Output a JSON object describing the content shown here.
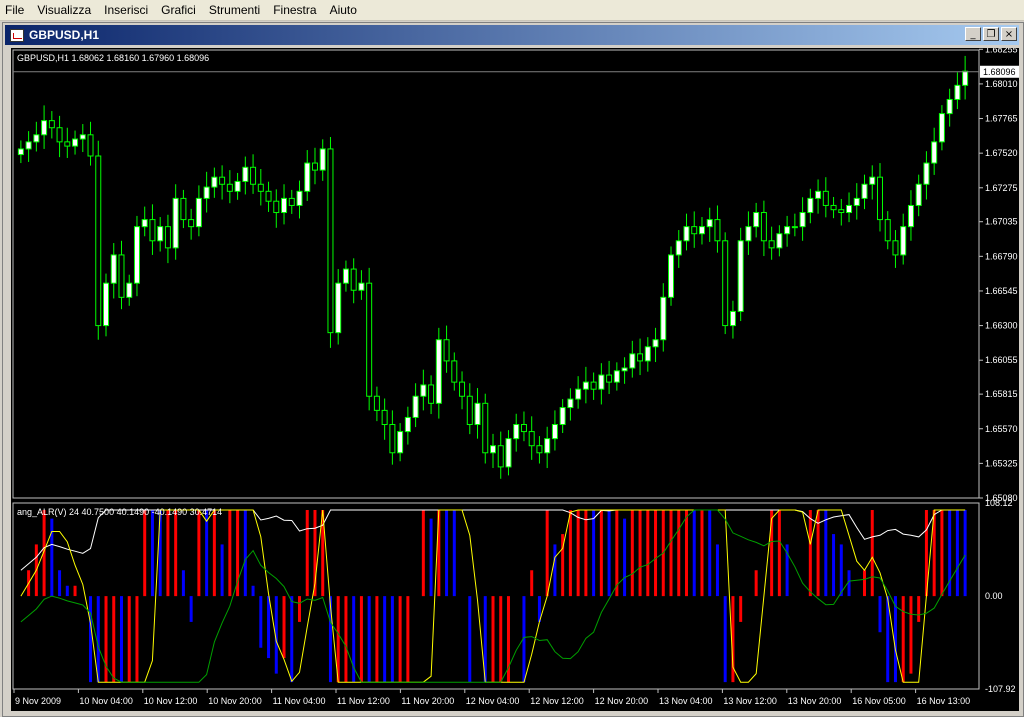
{
  "menu": {
    "items": [
      {
        "id": "file",
        "label": "File"
      },
      {
        "id": "visualizza",
        "label": "Visualizza"
      },
      {
        "id": "inserisci",
        "label": "Inserisci"
      },
      {
        "id": "grafici",
        "label": "Grafici"
      },
      {
        "id": "strumenti",
        "label": "Strumenti"
      },
      {
        "id": "finestra",
        "label": "Finestra"
      },
      {
        "id": "aiuto",
        "label": "Aiuto"
      }
    ]
  },
  "window": {
    "title": "GBPUSD,H1",
    "buttons": {
      "minimize": "_",
      "restore": "❐",
      "close": "×"
    }
  },
  "chart": {
    "symbol_info": "GBPUSD,H1  1.68062 1.68160 1.67960 1.68096",
    "current_price": "1.68096",
    "price_ticks": [
      "1.68255",
      "1.68010",
      "1.67765",
      "1.67520",
      "1.67275",
      "1.67035",
      "1.66790",
      "1.66545",
      "1.66300",
      "1.66055",
      "1.65815",
      "1.65570",
      "1.65325",
      "1.65080"
    ],
    "indicator_info": "ang_ALR(V) 24 40.7500 40.1490 -40.1490 30.4714",
    "indicator_ticks": [
      "108.12",
      "0.00",
      "-107.92"
    ],
    "time_ticks": [
      "9 Nov 2009",
      "10 Nov 04:00",
      "10 Nov 12:00",
      "10 Nov 20:00",
      "11 Nov 04:00",
      "11 Nov 12:00",
      "11 Nov 20:00",
      "12 Nov 04:00",
      "12 Nov 12:00",
      "12 Nov 20:00",
      "13 Nov 04:00",
      "13 Nov 12:00",
      "13 Nov 20:00",
      "16 Nov 05:00",
      "16 Nov 13:00"
    ],
    "colors": {
      "background": "#000000",
      "bull": "#ffffff",
      "bear": "#000000",
      "wick": "#00ff00",
      "hist_pos": "#ff0000",
      "hist_neg": "#0000ff",
      "line_white": "#ffffff",
      "line_yellow": "#ffff00",
      "line_green": "#00a000"
    }
  },
  "chart_data": {
    "type": "candlestick",
    "title": "GBPUSD,H1",
    "ylim": [
      1.6508,
      1.6825
    ],
    "closes": [
      1.6755,
      1.676,
      1.6765,
      1.6775,
      1.677,
      1.676,
      1.6757,
      1.6762,
      1.6765,
      1.675,
      1.663,
      1.666,
      1.668,
      1.665,
      1.666,
      1.67,
      1.6705,
      1.669,
      1.67,
      1.6685,
      1.672,
      1.6705,
      1.67,
      1.672,
      1.6728,
      1.6735,
      1.673,
      1.6725,
      1.6732,
      1.6742,
      1.673,
      1.6725,
      1.6718,
      1.671,
      1.672,
      1.6715,
      1.6725,
      1.6745,
      1.674,
      1.6755,
      1.6625,
      1.666,
      1.667,
      1.6655,
      1.666,
      1.658,
      1.657,
      1.656,
      1.654,
      1.6555,
      1.6565,
      1.658,
      1.6588,
      1.6575,
      1.662,
      1.6605,
      1.659,
      1.658,
      1.656,
      1.6575,
      1.654,
      1.6545,
      1.653,
      1.655,
      1.656,
      1.6555,
      1.6545,
      1.654,
      1.655,
      1.656,
      1.6572,
      1.6578,
      1.6585,
      1.659,
      1.6585,
      1.6595,
      1.659,
      1.6598,
      1.66,
      1.661,
      1.6605,
      1.6615,
      1.662,
      1.665,
      1.668,
      1.669,
      1.67,
      1.6695,
      1.67,
      1.6705,
      1.669,
      1.663,
      1.664,
      1.669,
      1.67,
      1.671,
      1.669,
      1.6685,
      1.6695,
      1.67,
      1.67,
      1.671,
      1.672,
      1.6725,
      1.6715,
      1.6712,
      1.671,
      1.6715,
      1.672,
      1.673,
      1.6735,
      1.6705,
      1.669,
      1.668,
      1.67,
      1.6715,
      1.673,
      1.6745,
      1.676,
      1.678,
      1.679,
      1.68,
      1.681
    ]
  }
}
